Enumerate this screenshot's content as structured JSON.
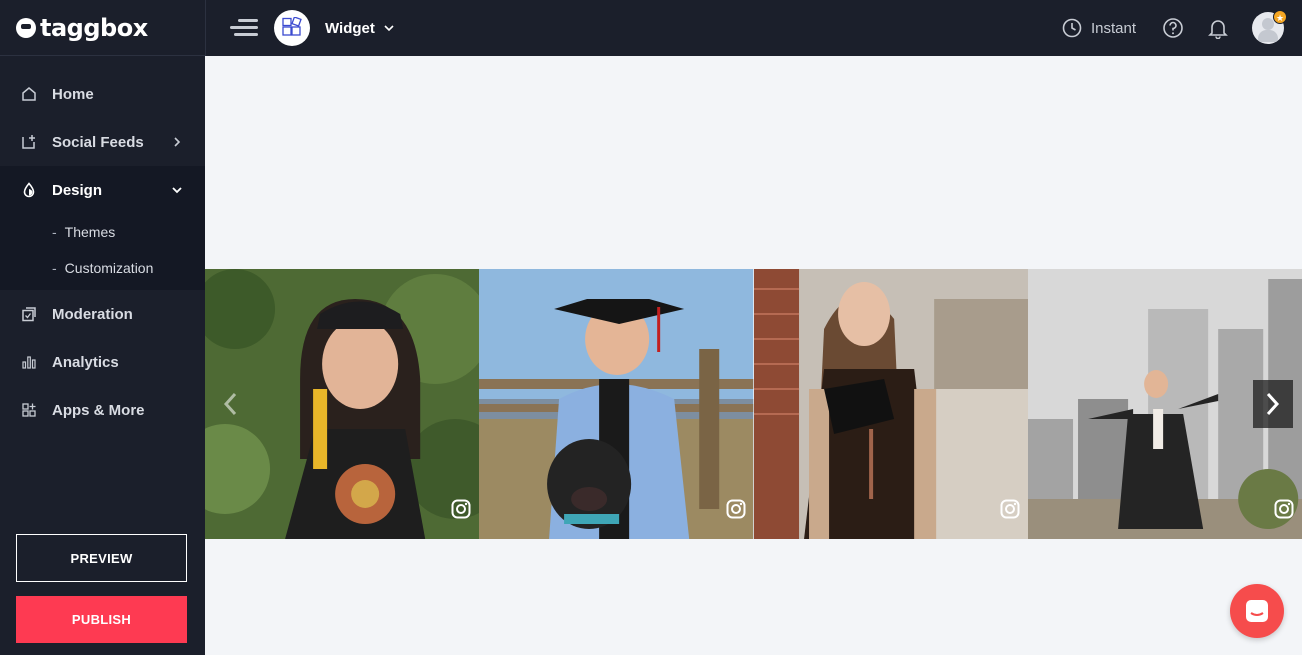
{
  "app": {
    "logo_text": "taggbox"
  },
  "sidebar": {
    "items": [
      {
        "label": "Home",
        "icon": "home-icon"
      },
      {
        "label": "Social Feeds",
        "icon": "add-feed-icon"
      },
      {
        "label": "Design",
        "icon": "droplet-icon",
        "expanded": true,
        "children": [
          {
            "label": "Themes"
          },
          {
            "label": "Customization"
          }
        ]
      },
      {
        "label": "Moderation",
        "icon": "moderation-icon"
      },
      {
        "label": "Analytics",
        "icon": "bar-chart-icon"
      },
      {
        "label": "Apps & More",
        "icon": "apps-grid-icon"
      }
    ],
    "preview_label": "PREVIEW",
    "publish_label": "PUBLISH"
  },
  "topbar": {
    "widget_label": "Widget",
    "instant_label": "Instant"
  },
  "gallery": {
    "posts": [
      {
        "source": "instagram"
      },
      {
        "source": "instagram"
      },
      {
        "source": "instagram"
      },
      {
        "source": "instagram"
      }
    ]
  },
  "colors": {
    "sidebar_bg": "#1b1f2b",
    "publish": "#fe3a52",
    "content_bg": "#f3f5f8",
    "chat": "#f64c4c"
  }
}
